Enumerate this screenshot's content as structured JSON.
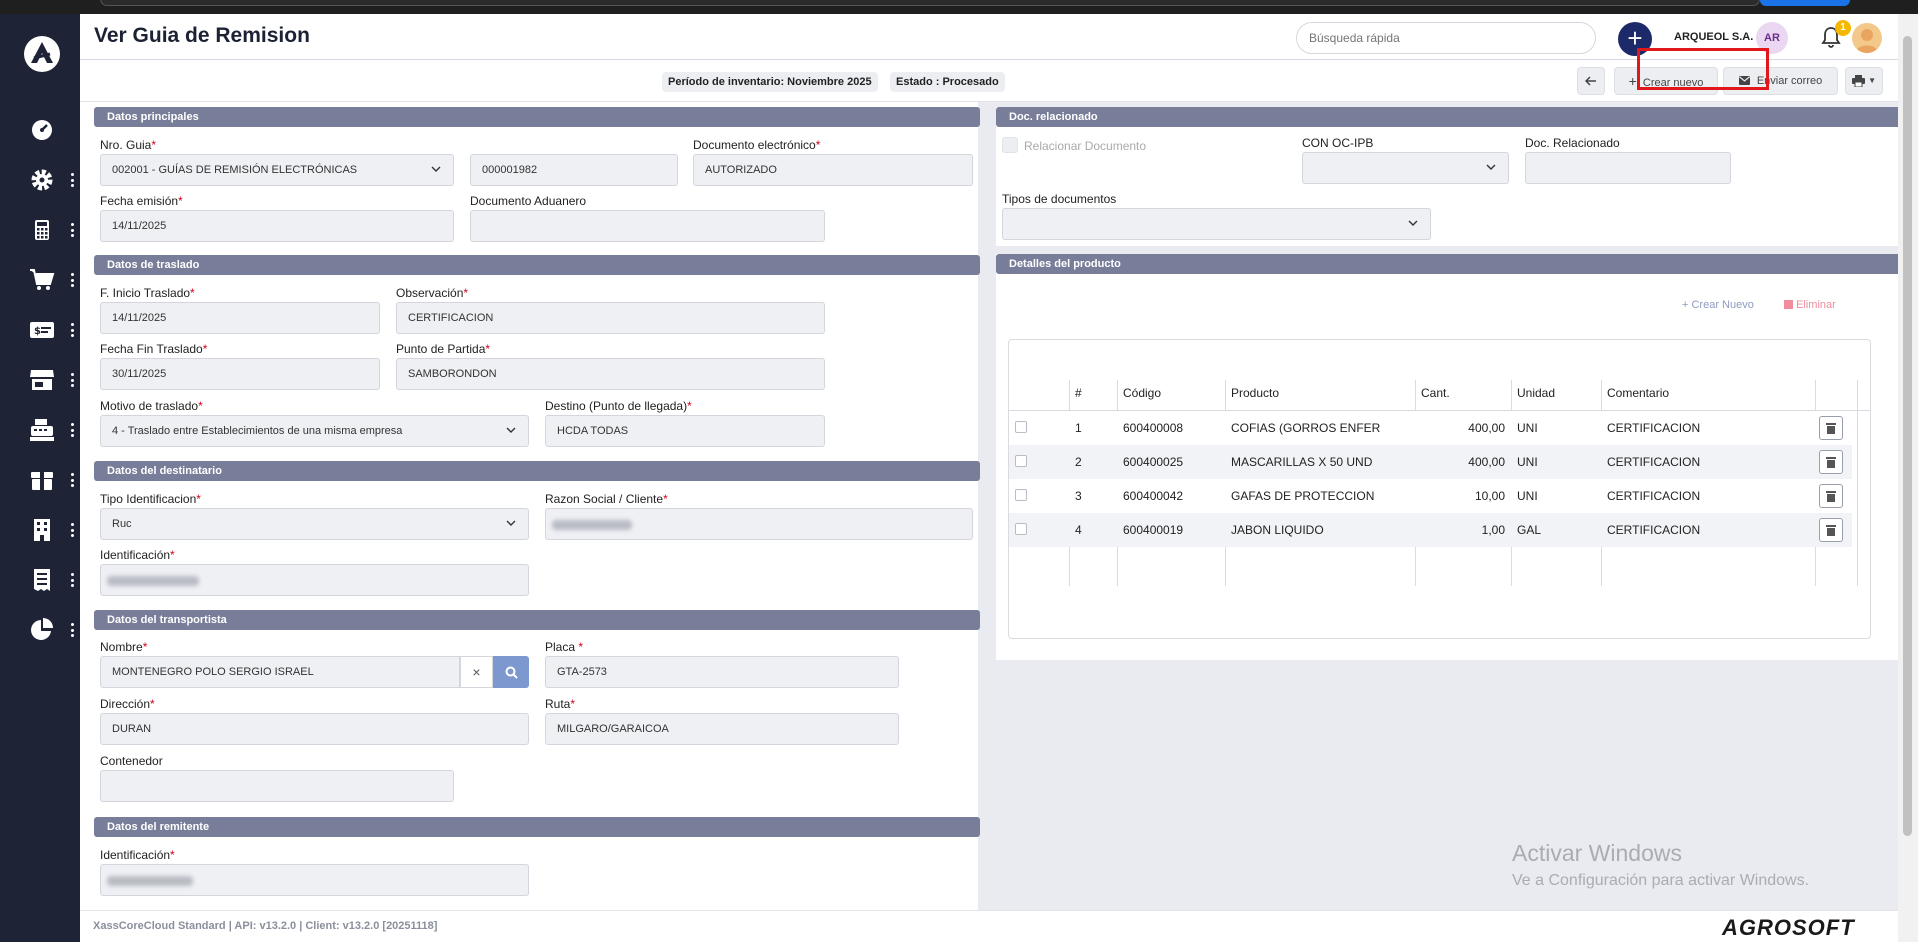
{
  "header": {
    "title": "Ver Guia de Remision",
    "search_placeholder": "Búsqueda rápida",
    "company": "ARQUEOL S.A.",
    "avatar_initials": "AR",
    "notification_count": "1"
  },
  "subbar": {
    "periodo": "Período de inventario: Noviembre 2025",
    "estado": "Estado : Procesado",
    "crear_nuevo": "Crear nuevo",
    "enviar_correo": "Enviar correo"
  },
  "datos_principales": {
    "title": "Datos principales",
    "nro_guia_label": "Nro. Guia",
    "nro_guia_select": "002001 - GUÍAS DE REMISIÓN ELECTRÓNICAS",
    "nro_guia_num": "000001982",
    "doc_electronico_label": "Documento electrónico",
    "doc_electronico": "AUTORIZADO",
    "fecha_emision_label": "Fecha emisión",
    "fecha_emision": "14/11/2025",
    "doc_aduanero_label": "Documento Aduanero"
  },
  "datos_traslado": {
    "title": "Datos de traslado",
    "f_inicio_label": "F. Inicio Traslado",
    "f_inicio": "14/11/2025",
    "observacion_label": "Observación",
    "observacion": "CERTIFICACION",
    "f_fin_label": "Fecha Fin Traslado",
    "f_fin": "30/11/2025",
    "punto_partida_label": "Punto de Partida",
    "punto_partida": "SAMBORONDON",
    "motivo_label": "Motivo de traslado",
    "motivo": "4 - Traslado entre Establecimientos de una misma empresa",
    "destino_label": "Destino (Punto de llegada)",
    "destino": "HCDA TODAS"
  },
  "datos_destinatario": {
    "title": "Datos del destinatario",
    "tipo_id_label": "Tipo Identificacion",
    "tipo_id": "Ruc",
    "razon_social_label": "Razon Social / Cliente",
    "identificacion_label": "Identificación"
  },
  "datos_transportista": {
    "title": "Datos del transportista",
    "nombre_label": "Nombre",
    "nombre": "MONTENEGRO POLO SERGIO ISRAEL",
    "placa_label": "Placa",
    "placa": "GTA-2573",
    "direccion_label": "Dirección",
    "direccion": "DURAN",
    "ruta_label": "Ruta",
    "ruta": "MILGARO/GARAICOA",
    "contenedor_label": "Contenedor"
  },
  "datos_remitente": {
    "title": "Datos del remitente",
    "identificacion_label": "Identificación"
  },
  "doc_relacionado": {
    "title": "Doc. relacionado",
    "relacionar_label": "Relacionar Documento",
    "con_oc_label": "CON OC-IPB",
    "doc_rel_label": "Doc. Relacionado",
    "tipos_label": "Tipos de documentos"
  },
  "detalles": {
    "title": "Detalles del producto",
    "crear_nuevo": "Crear Nuevo",
    "eliminar": "Eliminar",
    "columns": [
      "#",
      "Código",
      "Producto",
      "Cant.",
      "Unidad",
      "Comentario"
    ],
    "rows": [
      {
        "n": "1",
        "codigo": "600400008",
        "producto": "COFIAS (GORROS ENFER",
        "cant": "400,00",
        "unidad": "UNI",
        "comentario": "CERTIFICACION"
      },
      {
        "n": "2",
        "codigo": "600400025",
        "producto": "MASCARILLAS X 50 UND",
        "cant": "400,00",
        "unidad": "UNI",
        "comentario": "CERTIFICACION"
      },
      {
        "n": "3",
        "codigo": "600400042",
        "producto": "GAFAS DE PROTECCION",
        "cant": "10,00",
        "unidad": "UNI",
        "comentario": "CERTIFICACION"
      },
      {
        "n": "4",
        "codigo": "600400019",
        "producto": "JABON LIQUIDO",
        "cant": "1,00",
        "unidad": "GAL",
        "comentario": "CERTIFICACION"
      }
    ]
  },
  "footer": {
    "version": "XassCoreCloud Standard | API: v13.2.0 | Client: v13.2.0 [20251118]",
    "brand": "AGROSOFT"
  },
  "windows": {
    "line1": "Activar Windows",
    "line2": "Ve a Configuración para activar Windows."
  },
  "sidebar_icons": [
    "dashboard-icon",
    "settings-icon",
    "calculator-icon",
    "cart-icon",
    "money-icon",
    "store-icon",
    "cash-register-icon",
    "box-icon",
    "building-icon",
    "receipt-icon",
    "pie-chart-icon"
  ]
}
